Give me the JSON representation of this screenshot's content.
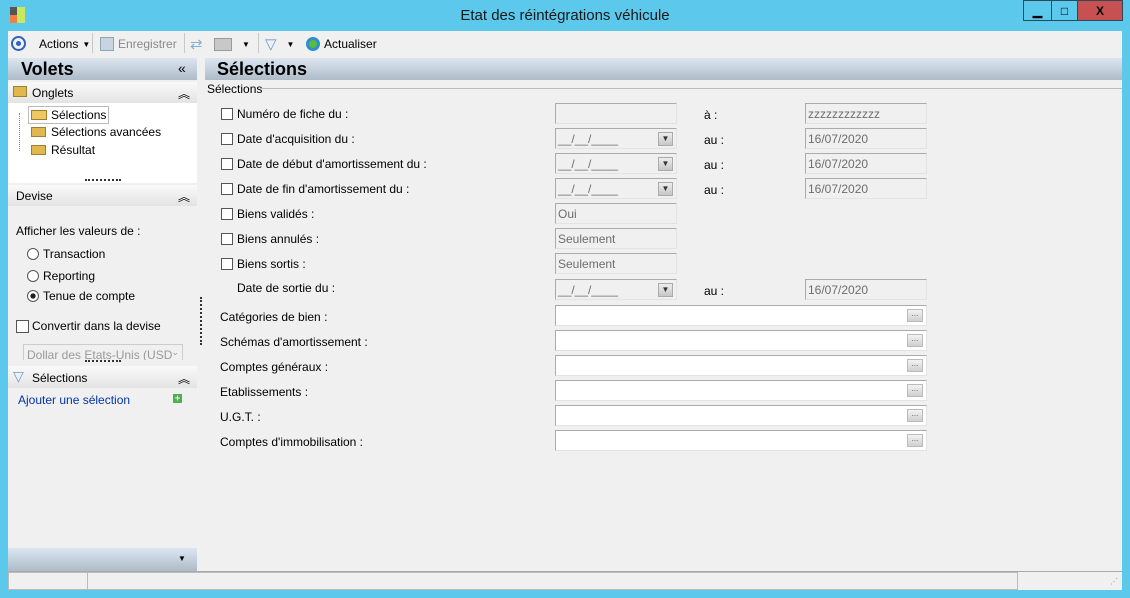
{
  "window": {
    "title": "Etat des réintégrations véhicule",
    "min": "▁",
    "max": "□",
    "close": "X"
  },
  "toolbar": {
    "actions": "Actions",
    "save": "Enregistrer",
    "refresh": "Actualiser"
  },
  "left": {
    "title": "Volets",
    "collapse": "«",
    "onglets": {
      "title": "Onglets",
      "items": [
        "Sélections",
        "Sélections avancées",
        "Résultat"
      ]
    },
    "devise": {
      "title": "Devise",
      "show_label": "Afficher les valeurs de :",
      "options": [
        "Transaction",
        "Reporting",
        "Tenue de compte"
      ],
      "selected": "Tenue de compte",
      "convert": "Convertir dans la devise",
      "currency": "Dollar des Etats-Unis (USD"
    },
    "selections": {
      "title": "Sélections",
      "add": "Ajouter une sélection"
    }
  },
  "main": {
    "title": "Sélections",
    "group": "Sélections",
    "rows": [
      {
        "label": "Numéro de fiche du :",
        "from": "",
        "to_label": "à :",
        "to": "zzzzzzzzzzzz"
      },
      {
        "label": "Date d'acquisition du :",
        "from": "__/__/____",
        "to_label": "au :",
        "to": "16/07/2020"
      },
      {
        "label": "Date de début d'amortissement du :",
        "from": "__/__/____",
        "to_label": "au :",
        "to": "16/07/2020"
      },
      {
        "label": "Date de fin d'amortissement du :",
        "from": "__/__/____",
        "to_label": "au :",
        "to": "16/07/2020"
      }
    ],
    "flags": [
      {
        "label": "Biens validés :",
        "value": "Oui"
      },
      {
        "label": "Biens annulés :",
        "value": "Seulement"
      },
      {
        "label": "Biens sortis :",
        "value": "Seulement"
      }
    ],
    "exit": {
      "label": "Date de sortie du :",
      "from": "__/__/____",
      "to_label": "au :",
      "to": "16/07/2020"
    },
    "lookups": [
      "Catégories de bien :",
      "Schémas d'amortissement :",
      "Comptes généraux :",
      "Etablissements :",
      "U.G.T. :",
      "Comptes d'immobilisation :"
    ],
    "lookup_btn": "..."
  }
}
